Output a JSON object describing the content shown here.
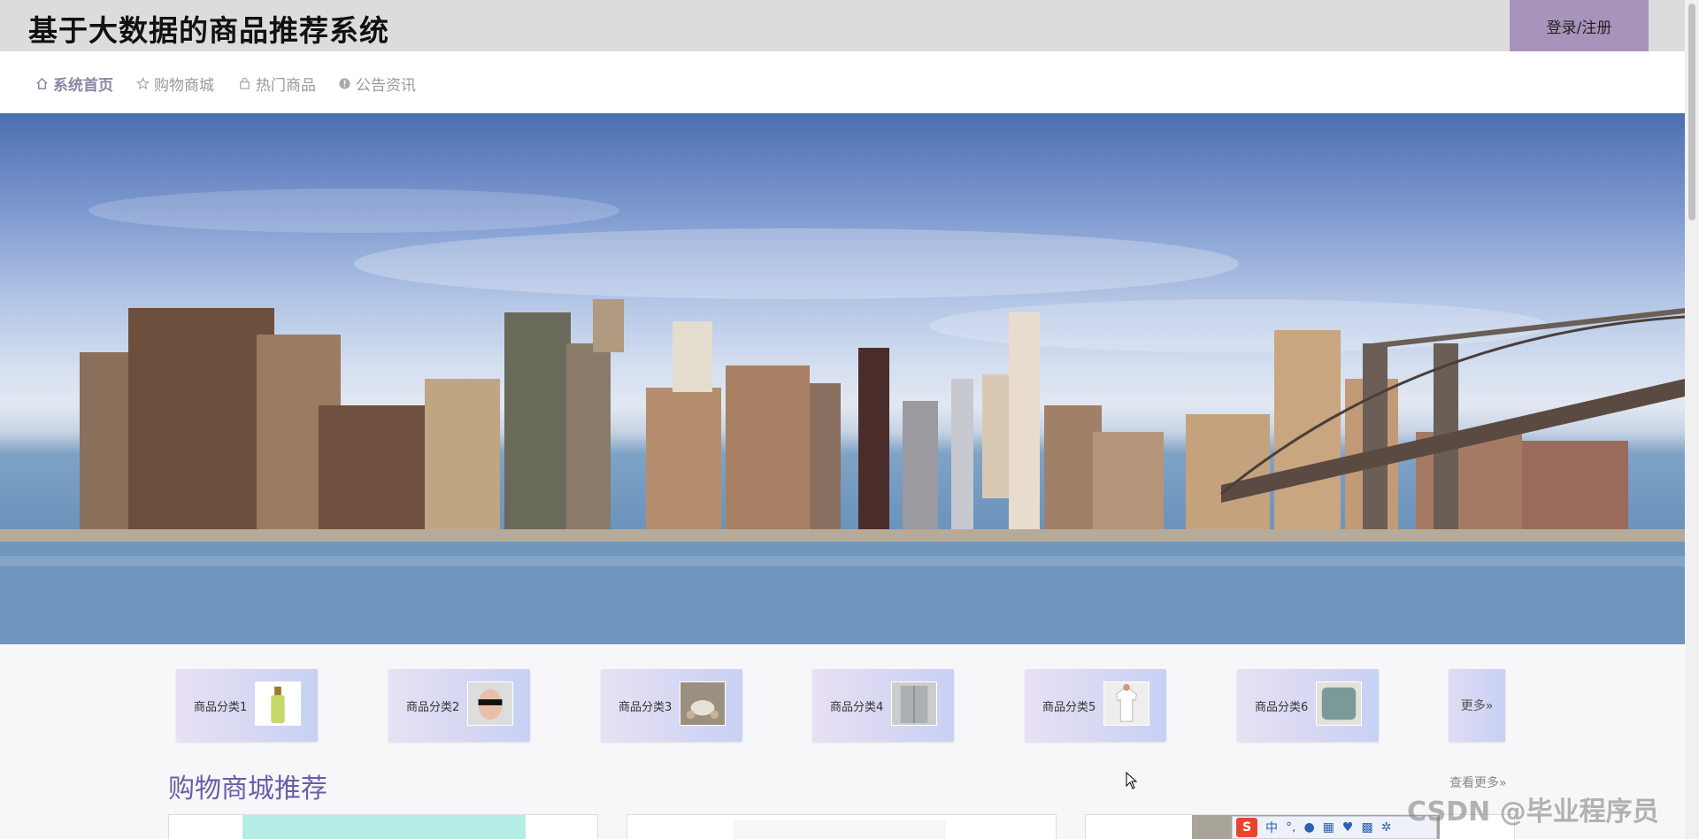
{
  "header": {
    "title": "基于大数据的商品推荐系统",
    "login_label": "登录/注册"
  },
  "nav": {
    "items": [
      {
        "label": "系统首页",
        "icon": "home-icon",
        "active": true
      },
      {
        "label": "购物商城",
        "icon": "star-icon",
        "active": false
      },
      {
        "label": "热门商品",
        "icon": "bag-icon",
        "active": false
      },
      {
        "label": "公告资讯",
        "icon": "alert-circle-icon",
        "active": false
      }
    ]
  },
  "categories": {
    "items": [
      {
        "label": "商品分类1",
        "thumb": "bottle-image"
      },
      {
        "label": "商品分类2",
        "thumb": "sunglasses-man-image"
      },
      {
        "label": "商品分类3",
        "thumb": "tea-set-image"
      },
      {
        "label": "商品分类4",
        "thumb": "refrigerator-image"
      },
      {
        "label": "商品分类5",
        "thumb": "white-tshirt-image"
      },
      {
        "label": "商品分类6",
        "thumb": "pillow-image"
      }
    ],
    "more_label": "更多»"
  },
  "section": {
    "title": "购物商城推荐",
    "view_more": "查看更多»"
  },
  "watermark": "CSDN @毕业程序员",
  "ime": {
    "logo": "S",
    "mode": "中"
  },
  "colors": {
    "topbar": "#dcdcdc",
    "login_button": "#a894ba",
    "section_title": "#6b5ea8"
  }
}
